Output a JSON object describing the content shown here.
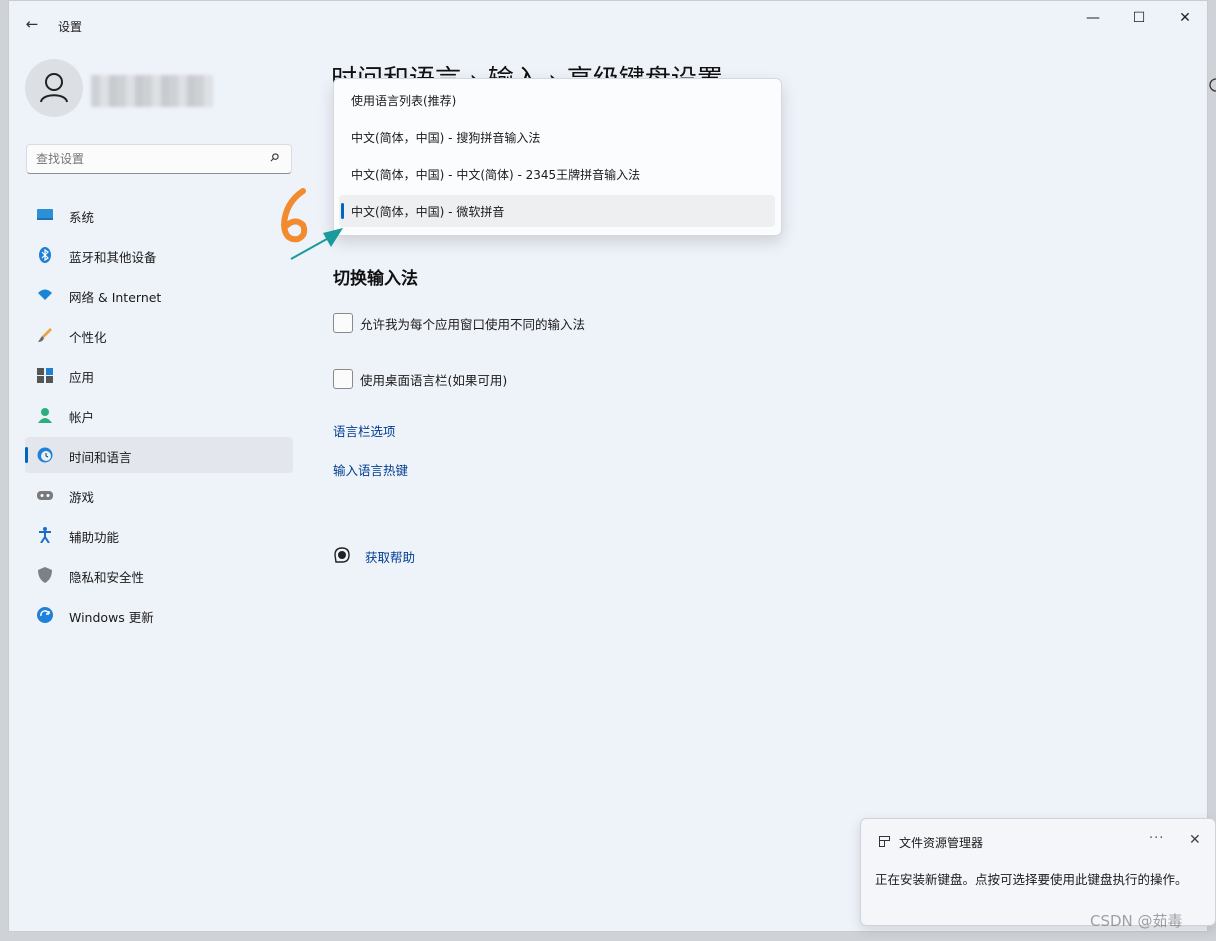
{
  "window": {
    "app_title": "设置",
    "back_glyph": "←",
    "controls": {
      "minimize": "—",
      "maximize": "☐",
      "close": "✕"
    }
  },
  "search": {
    "placeholder": "查找设置"
  },
  "sidebar": {
    "items": [
      {
        "label": "系统",
        "icon": "system-icon"
      },
      {
        "label": "蓝牙和其他设备",
        "icon": "bluetooth-icon"
      },
      {
        "label": "网络 & Internet",
        "icon": "wifi-icon"
      },
      {
        "label": "个性化",
        "icon": "brush-icon"
      },
      {
        "label": "应用",
        "icon": "apps-icon"
      },
      {
        "label": "帐户",
        "icon": "account-icon"
      },
      {
        "label": "时间和语言",
        "icon": "time-language-icon",
        "selected": true
      },
      {
        "label": "游戏",
        "icon": "gamepad-icon"
      },
      {
        "label": "辅助功能",
        "icon": "accessibility-icon"
      },
      {
        "label": "隐私和安全性",
        "icon": "shield-icon"
      },
      {
        "label": "Windows 更新",
        "icon": "update-icon"
      }
    ]
  },
  "breadcrumb": {
    "text": "时间和语言  ›  输入  ›  高级键盘设置",
    "items": [
      "时间和语言",
      "输入",
      "高级键盘设置"
    ],
    "separator": "›"
  },
  "dropdown": {
    "options": [
      "使用语言列表(推荐)",
      "中文(简体，中国) - 搜狗拼音输入法",
      "中文(简体，中国) - 中文(简体) - 2345王牌拼音输入法",
      "中文(简体，中国) - 微软拼音"
    ],
    "selected_index": 3
  },
  "annotation": {
    "step_number": "6",
    "number_color": "#f28a2e",
    "arrow_color": "#1a9a9a"
  },
  "section": {
    "heading": "切换输入法",
    "checkboxes": [
      {
        "label": "允许我为每个应用窗口使用不同的输入法",
        "checked": false
      },
      {
        "label": "使用桌面语言栏(如果可用)",
        "checked": false
      }
    ],
    "links": [
      "语言栏选项",
      "输入语言热键"
    ],
    "help": "获取帮助"
  },
  "toast": {
    "app_name": "文件资源管理器",
    "more_glyph": "···",
    "close_glyph": "✕",
    "body": "正在安装新键盘。点按可选择要使用此键盘执行的操作。"
  },
  "watermark": "CSDN @茹毒",
  "colors": {
    "accent": "#0067c0",
    "link": "#003e92",
    "window_bg": "#eef2f9"
  }
}
